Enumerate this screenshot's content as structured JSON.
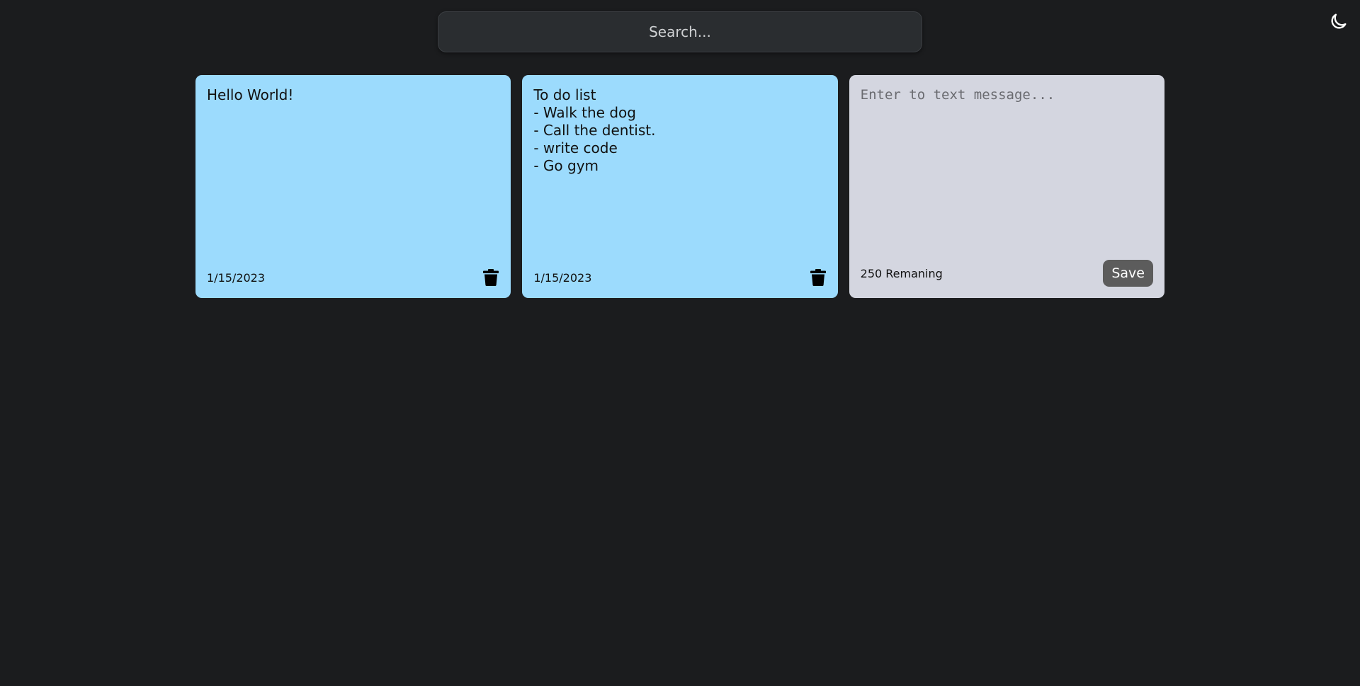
{
  "header": {
    "search_placeholder": "Search...",
    "theme_toggle_icon": "moon-icon"
  },
  "notes": [
    {
      "text": "Hello World!",
      "date": "1/15/2023",
      "delete_icon": "trash-icon"
    },
    {
      "text": "To do list\n- Walk the dog\n- Call the dentist.\n- write code\n- Go gym",
      "date": "1/15/2023",
      "delete_icon": "trash-icon"
    }
  ],
  "new_note": {
    "placeholder": "Enter to text message...",
    "remaining_text": "250 Remaning",
    "save_label": "Save"
  },
  "colors": {
    "background": "#1b1c1e",
    "note": "#9cdbfd",
    "new_note": "#d4d6e0",
    "save_button": "#5c5c5c"
  }
}
